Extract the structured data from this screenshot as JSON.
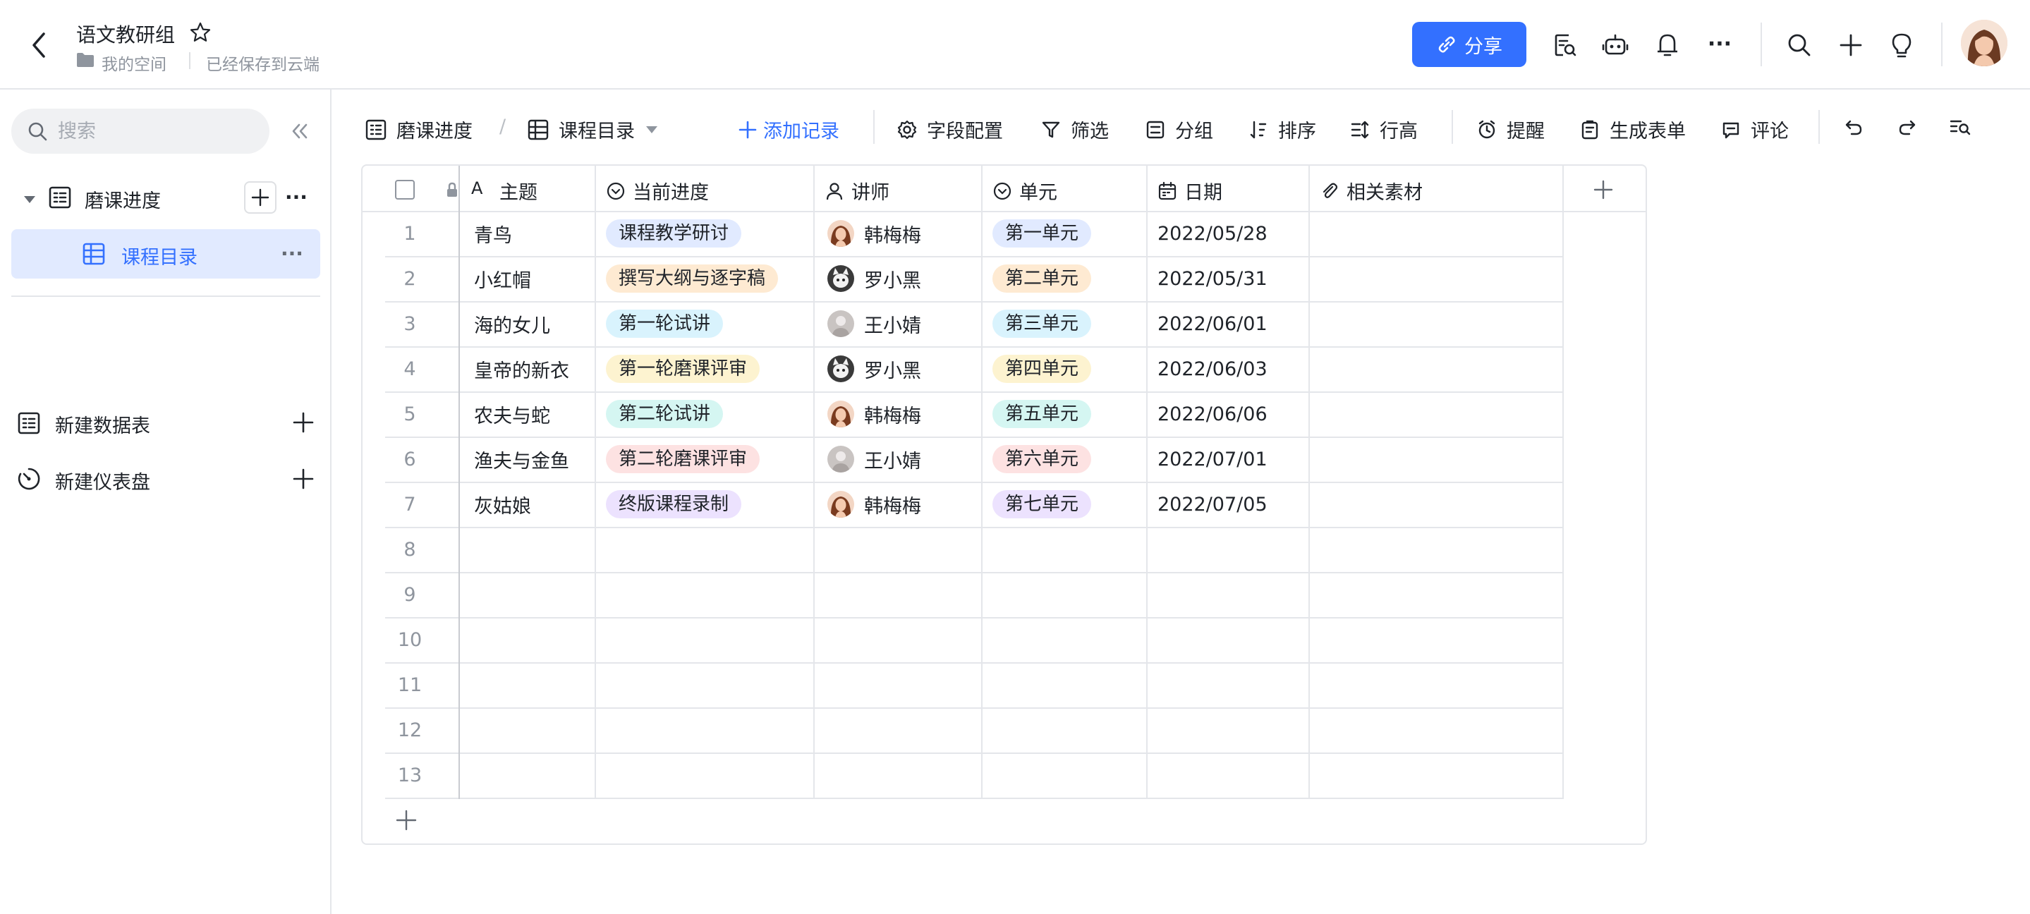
{
  "header": {
    "title": "语文教研组",
    "space": "我的空间",
    "save_status": "已经保存到云端",
    "share_label": "分享",
    "more_glyph": "···"
  },
  "sidebar": {
    "search_placeholder": "搜索",
    "tables": [
      {
        "label": "磨课进度"
      },
      {
        "label": "课程目录"
      }
    ],
    "new_table": "新建数据表",
    "new_dashboard": "新建仪表盘"
  },
  "toolbar": {
    "breadcrumb_parent": "磨课进度",
    "breadcrumb_sep": "/",
    "view_name": "课程目录",
    "add_record": "添加记录",
    "field_config": "字段配置",
    "filter": "筛选",
    "group": "分组",
    "sort": "排序",
    "row_height": "行高",
    "remind": "提醒",
    "form": "生成表单",
    "comment": "评论"
  },
  "table": {
    "columns": [
      "主题",
      "当前进度",
      "讲师",
      "单元",
      "日期",
      "相关素材"
    ],
    "rows": [
      {
        "n": "1",
        "topic": "青鸟",
        "progress": "课程教学研讨",
        "pcolor": "#e1eaff",
        "teacher": "韩梅梅",
        "unit": "第一单元",
        "ucolor": "#e1eaff",
        "date": "2022/05/28",
        "av": "woman"
      },
      {
        "n": "2",
        "topic": "小红帽",
        "progress": "撰写大纲与逐字稿",
        "pcolor": "#feead2",
        "teacher": "罗小黑",
        "unit": "第二单元",
        "ucolor": "#feead2",
        "date": "2022/05/31",
        "av": "cat"
      },
      {
        "n": "3",
        "topic": "海的女儿",
        "progress": "第一轮试讲",
        "pcolor": "#d9f3fd",
        "teacher": "王小婧",
        "unit": "第三单元",
        "ucolor": "#d9f3fd",
        "date": "2022/06/01",
        "av": "grey"
      },
      {
        "n": "4",
        "topic": "皇帝的新衣",
        "progress": "第一轮磨课评审",
        "pcolor": "#fdf3d0",
        "teacher": "罗小黑",
        "unit": "第四单元",
        "ucolor": "#fdf3d0",
        "date": "2022/06/03",
        "av": "cat"
      },
      {
        "n": "5",
        "topic": "农夫与蛇",
        "progress": "第二轮试讲",
        "pcolor": "#d5f6f2",
        "teacher": "韩梅梅",
        "unit": "第五单元",
        "ucolor": "#d5f6f2",
        "date": "2022/06/06",
        "av": "woman"
      },
      {
        "n": "6",
        "topic": "渔夫与金鱼",
        "progress": "第二轮磨课评审",
        "pcolor": "#fde2e2",
        "teacher": "王小婧",
        "unit": "第六单元",
        "ucolor": "#fde2e2",
        "date": "2022/07/01",
        "av": "grey"
      },
      {
        "n": "7",
        "topic": "灰姑娘",
        "progress": "终版课程录制",
        "pcolor": "#ece2fe",
        "teacher": "韩梅梅",
        "unit": "第七单元",
        "ucolor": "#ece2fe",
        "date": "2022/07/05",
        "av": "woman"
      }
    ],
    "empty_rows": [
      "8",
      "9",
      "10",
      "11",
      "12",
      "13"
    ]
  },
  "colors": {
    "accent": "#3370ff",
    "border": "#e4e6ea"
  }
}
